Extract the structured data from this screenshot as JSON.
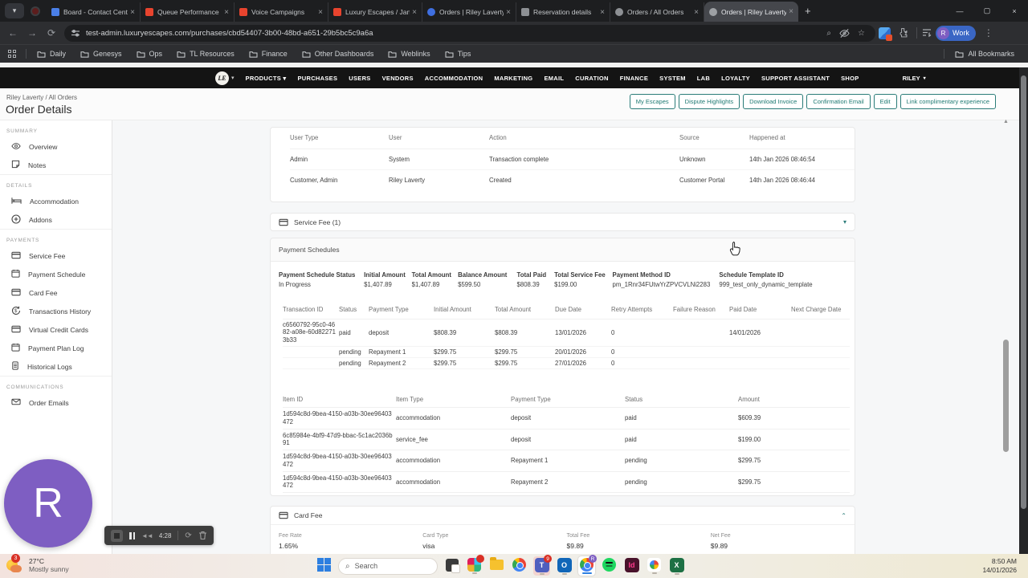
{
  "glyphs": {
    "chevron_down": "▾",
    "close": "×",
    "plus": "+",
    "minimize": "—",
    "maximize": "▢",
    "back": "←",
    "forward": "→",
    "reload": "⟳",
    "search": "⌕",
    "star": "☆",
    "kebab": "⋮",
    "rewind": "◄◄",
    "restart": "⟳",
    "up_triangle": "▲"
  },
  "browser": {
    "tabs": [
      {
        "label": "Board - Contact Centre |",
        "icon": "board",
        "color": "#4a7fe8",
        "shape": "square",
        "active": false
      },
      {
        "label": "Queue Performance",
        "icon": "genesys",
        "color": "#e8442e",
        "shape": "square",
        "active": false
      },
      {
        "label": "Voice Campaigns",
        "icon": "genesys",
        "color": "#e8442e",
        "shape": "square",
        "active": false
      },
      {
        "label": "Luxury Escapes / Januar",
        "icon": "genesys",
        "color": "#e8442e",
        "shape": "square",
        "active": false
      },
      {
        "label": "Orders | Riley Laverty | C",
        "icon": "orders",
        "color": "#3f6fe0",
        "shape": "round",
        "active": false
      },
      {
        "label": "Reservation details",
        "icon": "reservation",
        "color": "#8d9094",
        "shape": "square",
        "active": false
      },
      {
        "label": "Orders / All Orders",
        "icon": "globe",
        "color": "#8d9094",
        "shape": "round",
        "active": false
      },
      {
        "label": "Orders | Riley Laverty | C",
        "icon": "globe",
        "color": "#9da0a4",
        "shape": "round",
        "active": true
      }
    ],
    "url": "test-admin.luxuryescapes.com/purchases/cbd54407-3b00-48bd-a651-29b5bc5c9a6a",
    "bookmarks": [
      "Daily",
      "Genesys",
      "Ops",
      "TL Resources",
      "Finance",
      "Other Dashboards",
      "Weblinks",
      "Tips"
    ],
    "all_bookmarks_label": "All Bookmarks",
    "profile": {
      "initial": "R",
      "name": "Work"
    }
  },
  "site_nav": {
    "logo_text": "LE",
    "items": [
      "PRODUCTS",
      "PURCHASES",
      "USERS",
      "VENDORS",
      "ACCOMMODATION",
      "MARKETING",
      "EMAIL",
      "CURATION",
      "FINANCE",
      "SYSTEM",
      "LAB",
      "LOYALTY",
      "SUPPORT ASSISTANT",
      "SHOP"
    ],
    "user": "RILEY"
  },
  "page_header": {
    "breadcrumb": "Riley Laverty / All Orders",
    "title": "Order Details",
    "actions": [
      "My Escapes",
      "Dispute Highlights",
      "Download Invoice",
      "Confirmation Email",
      "Edit",
      "Link complimentary experience"
    ]
  },
  "sidebar": {
    "sections": [
      {
        "title": "SUMMARY",
        "items": [
          {
            "label": "Overview",
            "icon": "eye"
          },
          {
            "label": "Notes",
            "icon": "note"
          }
        ]
      },
      {
        "title": "DETAILS",
        "items": [
          {
            "label": "Accommodation",
            "icon": "bed"
          },
          {
            "label": "Addons",
            "icon": "plus-circle"
          }
        ]
      },
      {
        "title": "PAYMENTS",
        "items": [
          {
            "label": "Service Fee",
            "icon": "card"
          },
          {
            "label": "Payment Schedule",
            "icon": "calendar"
          },
          {
            "label": "Card Fee",
            "icon": "card"
          },
          {
            "label": "Transactions History",
            "icon": "refresh"
          },
          {
            "label": "Virtual Credit Cards",
            "icon": "card"
          },
          {
            "label": "Payment Plan Log",
            "icon": "calendar"
          },
          {
            "label": "Historical Logs",
            "icon": "doc"
          }
        ]
      },
      {
        "title": "COMMUNICATIONS",
        "items": [
          {
            "label": "Order Emails",
            "icon": "mail"
          }
        ]
      }
    ]
  },
  "audit_table": {
    "headers": [
      "User Type",
      "User",
      "Action",
      "Source",
      "Happened at"
    ],
    "rows": [
      [
        "Admin",
        "System",
        "Transaction complete",
        "Unknown",
        "14th Jan 2026 08:46:54"
      ],
      [
        "Customer, Admin",
        "Riley Laverty",
        "Created",
        "Customer Portal",
        "14th Jan 2026 08:46:44"
      ]
    ]
  },
  "service_fee_section": {
    "title": "Service Fee (1)"
  },
  "payment_schedule_section": {
    "title": "Payment Schedules",
    "summary": [
      {
        "label": "Payment Schedule Status",
        "value": "In Progress"
      },
      {
        "label": "Initial Amount",
        "value": "$1,407.89"
      },
      {
        "label": "Total Amount",
        "value": "$1,407.89"
      },
      {
        "label": "Balance Amount",
        "value": "$599.50"
      },
      {
        "label": "Total Paid",
        "value": "$808.39"
      },
      {
        "label": "Total Service Fee",
        "value": "$199.00"
      },
      {
        "label": "Payment Method ID",
        "value": "pm_1Rnr34FUtwYrZPVCVLNi2283"
      },
      {
        "label": "Schedule Template ID",
        "value": "999_test_only_dynamic_template"
      }
    ],
    "transactions": {
      "headers": [
        "Transaction ID",
        "Status",
        "Payment Type",
        "Initial Amount",
        "Total Amount",
        "Due Date",
        "Retry Attempts",
        "Failure Reason",
        "Paid Date",
        "Next Charge Date"
      ],
      "rows": [
        [
          "c6560792-95c0-4682-a08e-60d822713b33",
          "paid",
          "deposit",
          "$808.39",
          "$808.39",
          "13/01/2026",
          "0",
          "",
          "14/01/2026",
          ""
        ],
        [
          "",
          "pending",
          "Repayment 1",
          "$299.75",
          "$299.75",
          "20/01/2026",
          "0",
          "",
          "",
          ""
        ],
        [
          "",
          "pending",
          "Repayment 2",
          "$299.75",
          "$299.75",
          "27/01/2026",
          "0",
          "",
          "",
          ""
        ]
      ]
    },
    "items": {
      "headers": [
        "Item ID",
        "Item Type",
        "Payment Type",
        "Status",
        "Amount"
      ],
      "rows": [
        [
          "1d594c8d-9bea-4150-a03b-30ee96403472",
          "accommodation",
          "deposit",
          "paid",
          "$609.39"
        ],
        [
          "6c85984e-4bf9-47d9-bbac-5c1ac2036b91",
          "service_fee",
          "deposit",
          "paid",
          "$199.00"
        ],
        [
          "1d594c8d-9bea-4150-a03b-30ee96403472",
          "accommodation",
          "Repayment 1",
          "pending",
          "$299.75"
        ],
        [
          "1d594c8d-9bea-4150-a03b-30ee96403472",
          "accommodation",
          "Repayment 2",
          "pending",
          "$299.75"
        ]
      ]
    }
  },
  "card_fee_section": {
    "title": "Card Fee",
    "fields": [
      {
        "label": "Fee Rate",
        "value": "1.65%"
      },
      {
        "label": "Card Type",
        "value": "visa"
      },
      {
        "label": "Total Fee",
        "value": "$9.89"
      },
      {
        "label": "Net Fee",
        "value": "$9.89"
      }
    ]
  },
  "recording": {
    "initial": "R",
    "time": "4:28"
  },
  "taskbar": {
    "weather_temp": "27°C",
    "weather_desc": "Mostly sunny",
    "weather_badge": "3",
    "search_placeholder": "Search",
    "teams_badge": "9",
    "indesign_label": "Id",
    "excel_label": "X",
    "time": "8:50 AM",
    "date": "14/01/2026"
  },
  "colors": {
    "accent_teal": "#2b7c79",
    "purple": "#7e5ec2",
    "nav_dark": "#141414"
  }
}
